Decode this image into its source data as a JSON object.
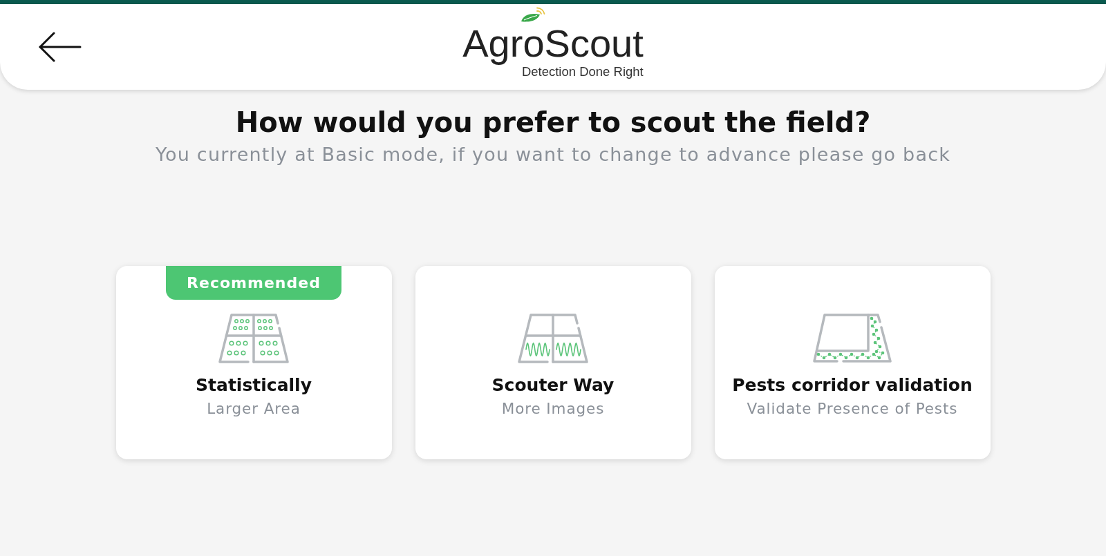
{
  "header": {
    "logo": {
      "name": "AgroScout",
      "tagline": "Detection Done Right"
    }
  },
  "prompt": {
    "title": "How would you prefer to scout the field?",
    "subtitle": "You currently at Basic mode, if you want to change to advance please go back"
  },
  "options": [
    {
      "kind": "sampling-grid",
      "badge": "Recommended",
      "title": "Statistically",
      "subtitle": "Larger Area"
    },
    {
      "kind": "wave-grid",
      "title": "Scouter Way",
      "subtitle": "More Images"
    },
    {
      "kind": "corridor",
      "title": "Pests corridor validation",
      "subtitle": "Validate Presence of Pests"
    }
  ]
}
